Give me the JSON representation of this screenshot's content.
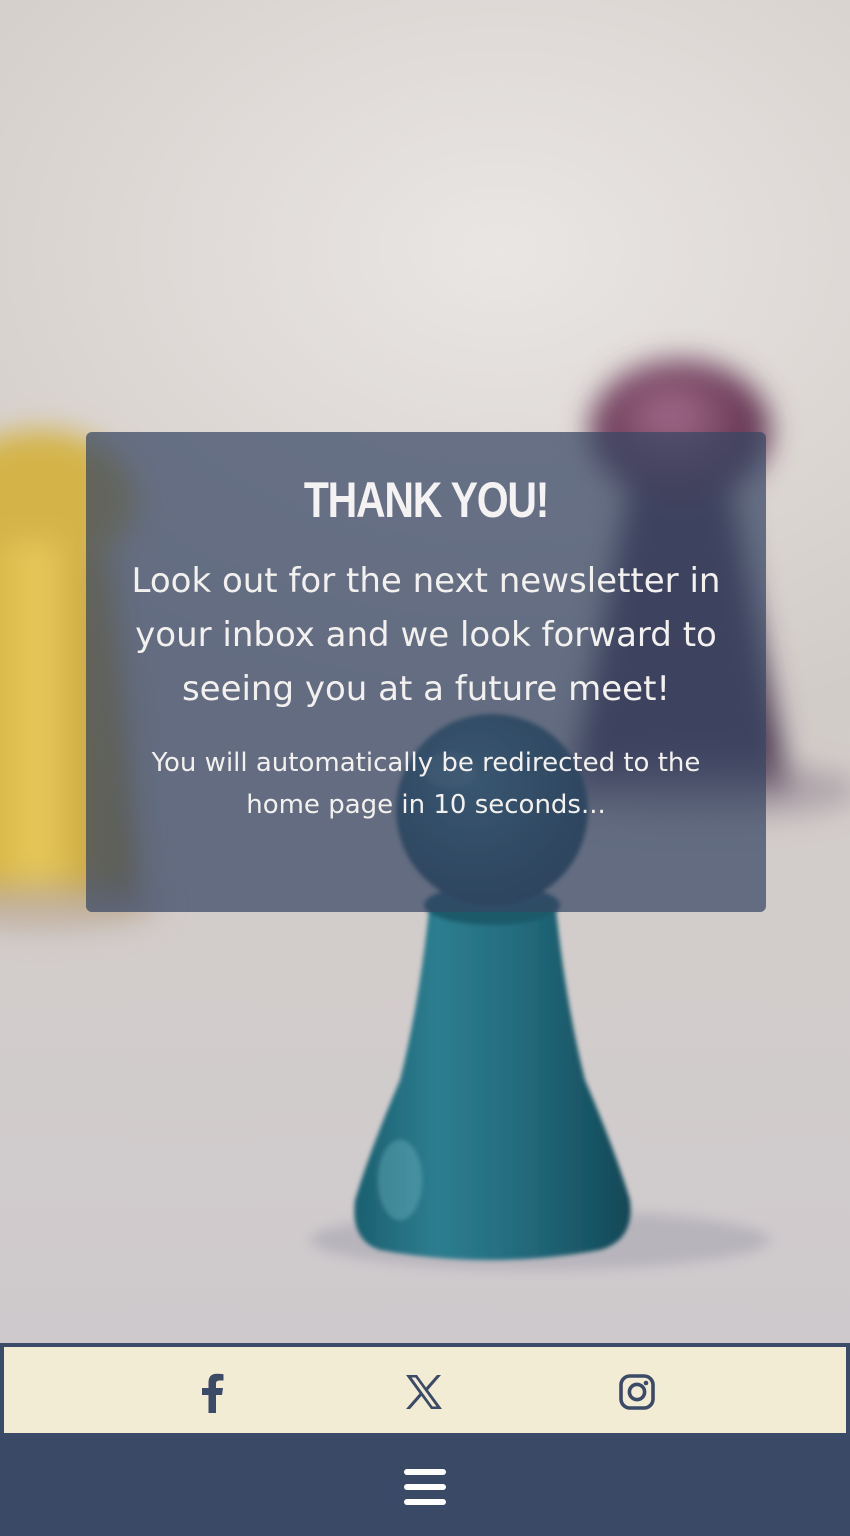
{
  "card": {
    "title": "THANK YOU!",
    "message": "Look out for the next newsletter in your inbox and we look forward to seeing you at a future meet!",
    "redirect_notice": "You will automatically be redirected to the home page in 10 seconds..."
  },
  "social": {
    "links": [
      {
        "name": "facebook",
        "icon": "facebook-icon"
      },
      {
        "name": "x",
        "icon": "x-icon"
      },
      {
        "name": "instagram",
        "icon": "instagram-icon"
      }
    ]
  },
  "nav": {
    "menu_icon": "hamburger-menu-icon"
  },
  "colors": {
    "card_background": "#384764",
    "social_bar_background": "#f3ecd4",
    "social_icon": "#3b4a66",
    "nav_background": "#3a4a66",
    "text": "#ffffff"
  }
}
